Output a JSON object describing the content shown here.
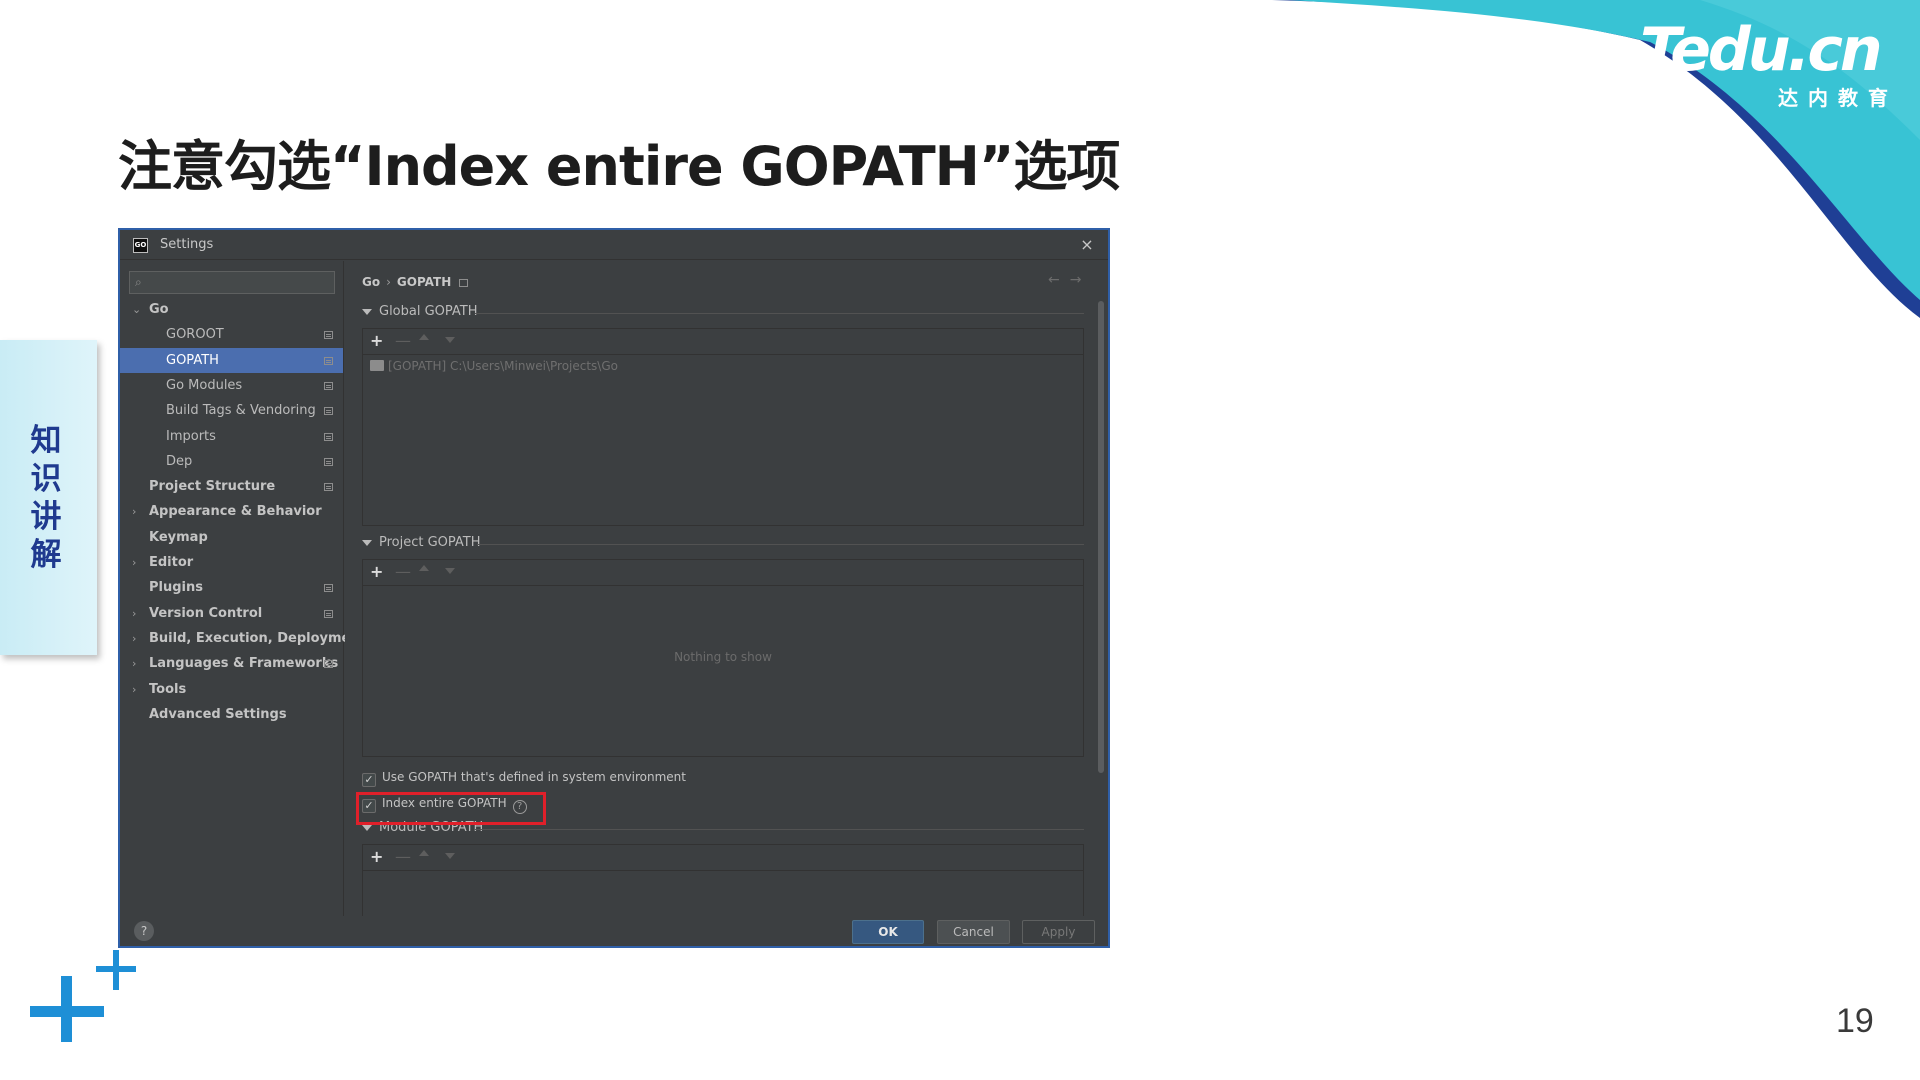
{
  "slide": {
    "title": "注意勾选“Index entire GOPATH”选项",
    "side_tab": "知识讲解",
    "page_number": "19",
    "brand": {
      "name": "Tedu.cn",
      "subtitle": "达内教育"
    },
    "colors": {
      "accent_blue": "#1e8fd6",
      "swoosh_teal": "#38c3d4",
      "swoosh_navy": "#1f3f95",
      "title_text": "#1d1d1d",
      "side_tab_text": "#1f3a8f",
      "highlight_red": "#e0202a"
    }
  },
  "dialog": {
    "title": "Settings",
    "app_icon": "GO",
    "close_icon": "×",
    "search": {
      "placeholder": "",
      "icon": "search-icon"
    },
    "tree": [
      {
        "label": "Go",
        "level": 0,
        "expandable": true,
        "expanded": true,
        "bold": true,
        "page_icon": false,
        "selected": false
      },
      {
        "label": "GOROOT",
        "level": 1,
        "expandable": false,
        "bold": false,
        "page_icon": true,
        "selected": false
      },
      {
        "label": "GOPATH",
        "level": 1,
        "expandable": false,
        "bold": false,
        "page_icon": true,
        "selected": true
      },
      {
        "label": "Go Modules",
        "level": 1,
        "expandable": false,
        "bold": false,
        "page_icon": true,
        "selected": false
      },
      {
        "label": "Build Tags & Vendoring",
        "level": 1,
        "expandable": false,
        "bold": false,
        "page_icon": true,
        "selected": false
      },
      {
        "label": "Imports",
        "level": 1,
        "expandable": false,
        "bold": false,
        "page_icon": true,
        "selected": false
      },
      {
        "label": "Dep",
        "level": 1,
        "expandable": false,
        "bold": false,
        "page_icon": true,
        "selected": false
      },
      {
        "label": "Project Structure",
        "level": 0,
        "expandable": false,
        "bold": true,
        "page_icon": true,
        "selected": false
      },
      {
        "label": "Appearance & Behavior",
        "level": 0,
        "expandable": true,
        "bold": true,
        "page_icon": false,
        "selected": false
      },
      {
        "label": "Keymap",
        "level": 0,
        "expandable": false,
        "bold": true,
        "page_icon": false,
        "selected": false
      },
      {
        "label": "Editor",
        "level": 0,
        "expandable": true,
        "bold": true,
        "page_icon": false,
        "selected": false
      },
      {
        "label": "Plugins",
        "level": 0,
        "expandable": false,
        "bold": true,
        "page_icon": true,
        "selected": false
      },
      {
        "label": "Version Control",
        "level": 0,
        "expandable": true,
        "bold": true,
        "page_icon": true,
        "selected": false
      },
      {
        "label": "Build, Execution, Deployment",
        "level": 0,
        "expandable": true,
        "bold": true,
        "page_icon": false,
        "selected": false
      },
      {
        "label": "Languages & Frameworks",
        "level": 0,
        "expandable": true,
        "bold": true,
        "page_icon": true,
        "selected": false
      },
      {
        "label": "Tools",
        "level": 0,
        "expandable": true,
        "bold": true,
        "page_icon": false,
        "selected": false
      },
      {
        "label": "Advanced Settings",
        "level": 0,
        "expandable": false,
        "bold": true,
        "page_icon": false,
        "selected": false
      }
    ],
    "breadcrumb": {
      "parent": "Go",
      "separator": "›",
      "current": "GOPATH"
    },
    "nav": {
      "back": "←",
      "forward": "→"
    },
    "global_gopath": {
      "header": "Global GOPATH",
      "toolbar": {
        "add": "+",
        "remove": "—"
      },
      "entries": [
        "[GOPATH] C:\\Users\\Minwei\\Projects\\Go"
      ]
    },
    "project_gopath": {
      "header": "Project GOPATH",
      "toolbar": {
        "add": "+",
        "remove": "—"
      },
      "empty_text": "Nothing to show"
    },
    "use_system_gopath": {
      "label": "Use GOPATH that's defined in system environment",
      "checked": true
    },
    "index_entire_gopath": {
      "label": "Index entire GOPATH",
      "checked": true,
      "help": "?"
    },
    "module_gopath": {
      "header": "Module GOPATH",
      "toolbar": {
        "add": "+",
        "remove": "—"
      }
    },
    "footer": {
      "help": "?",
      "ok": "OK",
      "cancel": "Cancel",
      "apply": "Apply"
    }
  }
}
